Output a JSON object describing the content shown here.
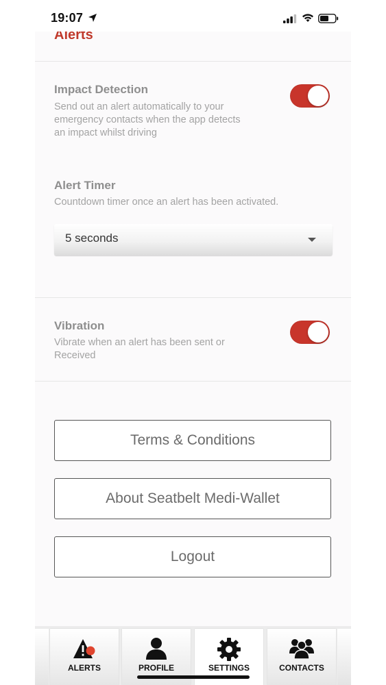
{
  "status_bar": {
    "time": "19:07"
  },
  "section": {
    "title": "Alerts"
  },
  "impact_detection": {
    "title": "Impact Detection",
    "description_lines": [
      "Send out an alert automatically to your",
      "emergency contacts when the app detects",
      "an impact whilst driving"
    ],
    "enabled": true
  },
  "alert_timer": {
    "title": "Alert Timer",
    "description": "Countdown timer once an alert has been activated.",
    "selected": "5 seconds"
  },
  "vibration": {
    "title": "Vibration",
    "description_lines": [
      "Vibrate when an alert has been sent or",
      "Received"
    ],
    "enabled": true
  },
  "buttons": {
    "terms": "Terms & Conditions",
    "about": "About Seatbelt Medi-Wallet",
    "logout": "Logout"
  },
  "tabs": [
    {
      "label": "ALERTS",
      "icon": "alert-icon"
    },
    {
      "label": "PROFILE",
      "icon": "person-icon"
    },
    {
      "label": "SETTINGS",
      "icon": "gear-icon"
    },
    {
      "label": "CONTACTS",
      "icon": "group-icon"
    }
  ],
  "colors": {
    "accent": "#c8352b",
    "title_red": "#c0392b"
  }
}
